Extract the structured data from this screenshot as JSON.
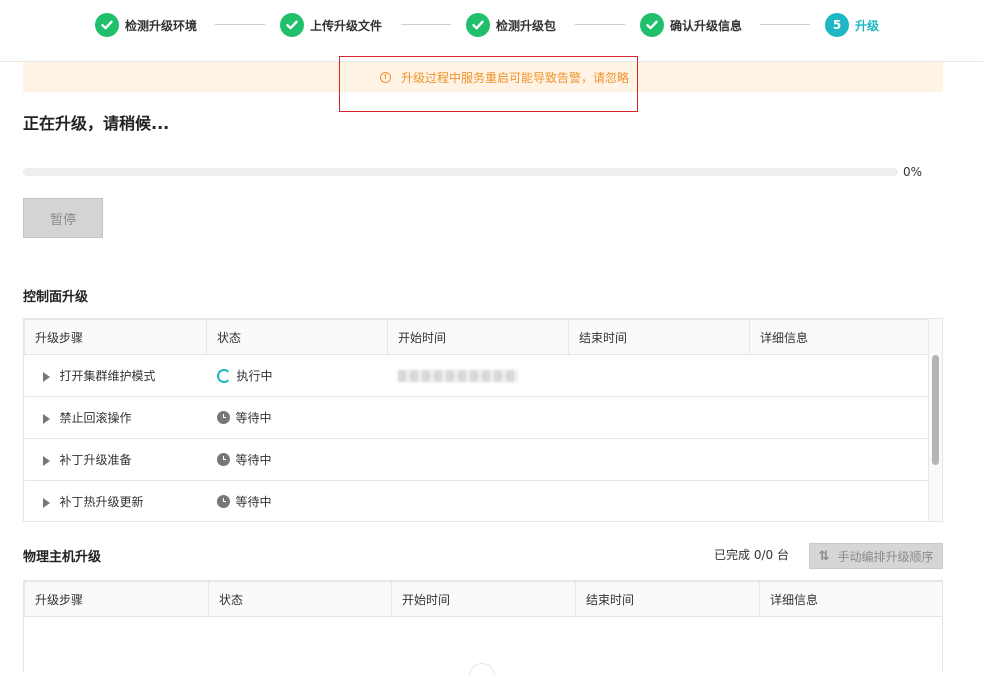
{
  "steps": [
    {
      "label": "检测升级环境",
      "state": "done"
    },
    {
      "label": "上传升级文件",
      "state": "done"
    },
    {
      "label": "检测升级包",
      "state": "done"
    },
    {
      "label": "确认升级信息",
      "state": "done"
    },
    {
      "label": "升级",
      "state": "active",
      "number": "5"
    }
  ],
  "banner": {
    "text": "升级过程中服务重启可能导致告警，请忽略",
    "icon": "info-circle-icon"
  },
  "main": {
    "status_title": "正在升级，请稍候...",
    "progress": {
      "percent": 0,
      "label": "0%"
    },
    "pause_label": "暂停"
  },
  "control_plane": {
    "title": "控制面升级",
    "columns": [
      "升级步骤",
      "状态",
      "开始时间",
      "结束时间",
      "详细信息"
    ],
    "rows": [
      {
        "step": "打开集群维护模式",
        "status": "执行中",
        "status_icon": "running-icon",
        "start": "",
        "end": "",
        "detail": ""
      },
      {
        "step": "禁止回滚操作",
        "status": "等待中",
        "status_icon": "clock-icon",
        "start": "",
        "end": "",
        "detail": ""
      },
      {
        "step": "补丁升级准备",
        "status": "等待中",
        "status_icon": "clock-icon",
        "start": "",
        "end": "",
        "detail": ""
      },
      {
        "step": "补丁热升级更新",
        "status": "等待中",
        "status_icon": "clock-icon",
        "start": "",
        "end": "",
        "detail": ""
      }
    ]
  },
  "physical_hosts": {
    "title": "物理主机升级",
    "completed_text": "已完成 0/0 台",
    "manual_button": "手动编排升级顺序",
    "columns": [
      "升级步骤",
      "状态",
      "开始时间",
      "结束时间",
      "详细信息"
    ]
  },
  "colors": {
    "accent": "#1db8c4",
    "done": "#20bf6b",
    "warning": "#f0932b",
    "highlight": "#d9232a"
  }
}
